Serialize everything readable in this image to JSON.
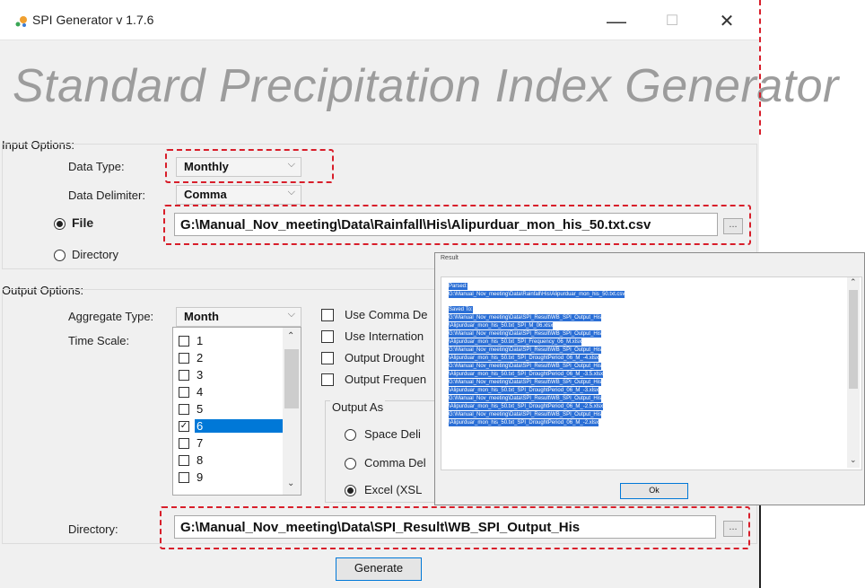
{
  "window": {
    "title": "SPI Generator  v 1.7.6",
    "minimize": "—",
    "maximize": "☐",
    "close": "✕"
  },
  "banner": "Standard Precipitation Index Generator",
  "input_options": {
    "label": "Input Options:",
    "data_type_label": "Data Type:",
    "data_type_value": "Monthly",
    "data_delimiter_label": "Data Delimiter:",
    "data_delimiter_value": "Comma",
    "file_radio_label": "File",
    "directory_radio_label": "Directory",
    "file_path": "G:\\Manual_Nov_meeting\\Data\\Rainfall\\His\\Alipurduar_mon_his_50.txt.csv",
    "browse_label": "..."
  },
  "output_options": {
    "label": "Output Options:",
    "aggregate_type_label": "Aggregate Type:",
    "aggregate_type_value": "Month",
    "time_scale_label": "Time Scale:",
    "time_scale_items": [
      "1",
      "2",
      "3",
      "4",
      "5",
      "6",
      "7",
      "8",
      "9"
    ],
    "selected_time_scale": "6",
    "checkbox_use_comma": "Use Comma De",
    "checkbox_use_international": "Use Internation",
    "checkbox_output_drought": "Output Drought",
    "checkbox_output_frequency": "Output Frequen",
    "output_as_label": "Output As",
    "radio_space": "Space Deli",
    "radio_comma": "Comma Del",
    "radio_excel": "Excel (XSL",
    "directory_label": "Directory:",
    "directory_path": "G:\\Manual_Nov_meeting\\Data\\SPI_Result\\WB_SPI_Output_His",
    "browse_label": "..."
  },
  "generate_button": "Generate",
  "popup": {
    "title": "Result",
    "lines": [
      "Parsed:",
      "G:\\Manual_Nov_meeting\\Data\\Rainfall\\His\\Alipurduar_mon_his_50.txt.csv",
      "Saved To:",
      "G:\\Manual_Nov_meeting\\Data\\SPI_Result\\WB_SPI_Output_His",
      "\\Alipurduar_mon_his_50.txt_SPI_M_06.xlsx",
      "G:\\Manual_Nov_meeting\\Data\\SPI_Result\\WB_SPI_Output_His",
      "\\Alipurduar_mon_his_50.txt_SPI_Frequency_06_M.xlsx",
      "G:\\Manual_Nov_meeting\\Data\\SPI_Result\\WB_SPI_Output_His",
      "\\Alipurduar_mon_his_50.txt_SPI_DroughtPeriod_06_M_-4.xlsx",
      "G:\\Manual_Nov_meeting\\Data\\SPI_Result\\WB_SPI_Output_His",
      "\\Alipurduar_mon_his_50.txt_SPI_DroughtPeriod_06_M_-3.5.xlsx",
      "G:\\Manual_Nov_meeting\\Data\\SPI_Result\\WB_SPI_Output_His",
      "\\Alipurduar_mon_his_50.txt_SPI_DroughtPeriod_06_M_-3.xlsx",
      "G:\\Manual_Nov_meeting\\Data\\SPI_Result\\WB_SPI_Output_His",
      "\\Alipurduar_mon_his_50.txt_SPI_DroughtPeriod_06_M_-2.5.xlsx",
      "G:\\Manual_Nov_meeting\\Data\\SPI_Result\\WB_SPI_Output_His",
      "\\Alipurduar_mon_his_50.txt_SPI_DroughtPeriod_06_M_-2.xlsx"
    ],
    "ok_label": "Ok"
  },
  "colors": {
    "highlight": "#d81e2a",
    "selection": "#0078d7",
    "banner_text": "#9c9c9c"
  }
}
